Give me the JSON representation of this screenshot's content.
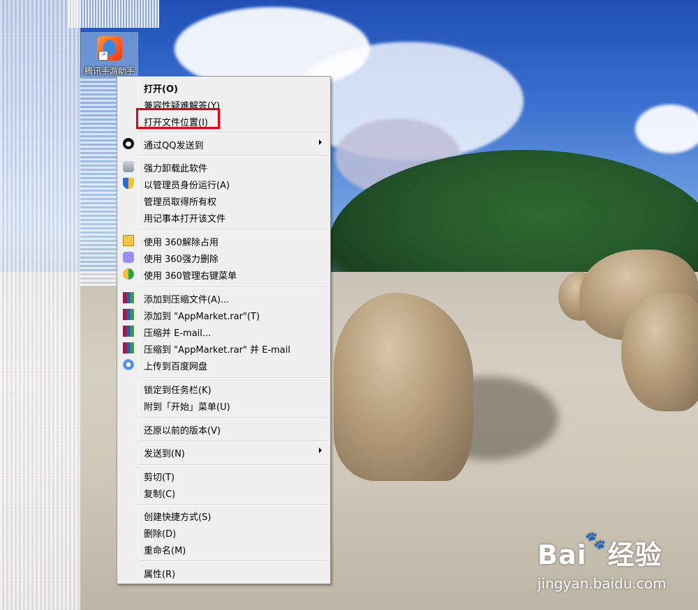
{
  "desktop": {
    "shortcut_label": "腾讯手游助手",
    "shortcut_icon": "tencent-gaming-assistant-icon"
  },
  "context_menu": {
    "items": [
      {
        "label": "打开(O)",
        "bold": true
      },
      {
        "label": "兼容性疑难解答(Y)"
      },
      {
        "label": "打开文件位置(I)",
        "highlighted": true
      },
      {
        "label": "通过QQ发送到",
        "icon": "qq-icon",
        "submenu": true
      },
      {
        "label": "强力卸载此软件",
        "icon": "recycle-bin-icon"
      },
      {
        "label": "以管理员身份运行(A)",
        "icon": "uac-shield-icon"
      },
      {
        "label": "管理员取得所有权"
      },
      {
        "label": "用记事本打开该文件"
      },
      {
        "label": "使用 360解除占用",
        "icon": "360-unlock-icon"
      },
      {
        "label": "使用 360强力删除",
        "icon": "360-shred-icon"
      },
      {
        "label": "使用 360管理右键菜单",
        "icon": "360-menu-manager-icon"
      },
      {
        "label": "添加到压缩文件(A)...",
        "icon": "winrar-icon"
      },
      {
        "label": "添加到 \"AppMarket.rar\"(T)",
        "icon": "winrar-icon"
      },
      {
        "label": "压缩并 E-mail...",
        "icon": "winrar-icon"
      },
      {
        "label": "压缩到 \"AppMarket.rar\" 并 E-mail",
        "icon": "winrar-icon"
      },
      {
        "label": "上传到百度网盘",
        "icon": "baidu-netdisk-icon"
      },
      {
        "label": "锁定到任务栏(K)"
      },
      {
        "label": "附到「开始」菜单(U)"
      },
      {
        "label": "还原以前的版本(V)"
      },
      {
        "label": "发送到(N)",
        "submenu": true
      },
      {
        "label": "剪切(T)"
      },
      {
        "label": "复制(C)"
      },
      {
        "label": "创建快捷方式(S)"
      },
      {
        "label": "删除(D)"
      },
      {
        "label": "重命名(M)"
      },
      {
        "label": "属性(R)"
      }
    ],
    "highlight_color": "#e60012"
  },
  "watermark": {
    "brand": "Bai",
    "brand_suffix": "经验",
    "url": "jingyan.baidu.com"
  }
}
